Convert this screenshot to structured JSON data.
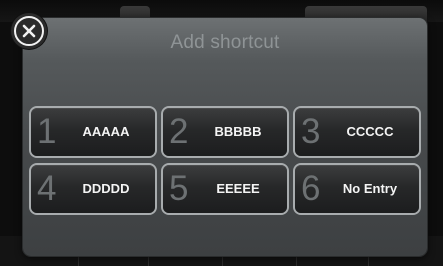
{
  "dialog": {
    "title": "Add shortcut"
  },
  "close": {
    "icon": "close-icon"
  },
  "shortcuts": [
    {
      "number": "1",
      "label": "AAAAA"
    },
    {
      "number": "2",
      "label": "BBBBB"
    },
    {
      "number": "3",
      "label": "CCCCC"
    },
    {
      "number": "4",
      "label": "DDDDD"
    },
    {
      "number": "5",
      "label": "EEEEE"
    },
    {
      "number": "6",
      "label": "No Entry"
    }
  ],
  "colors": {
    "panel": "#55595b",
    "slot_border": "#a8acae",
    "slot_number": "#6d7173",
    "title": "#8f9496"
  }
}
